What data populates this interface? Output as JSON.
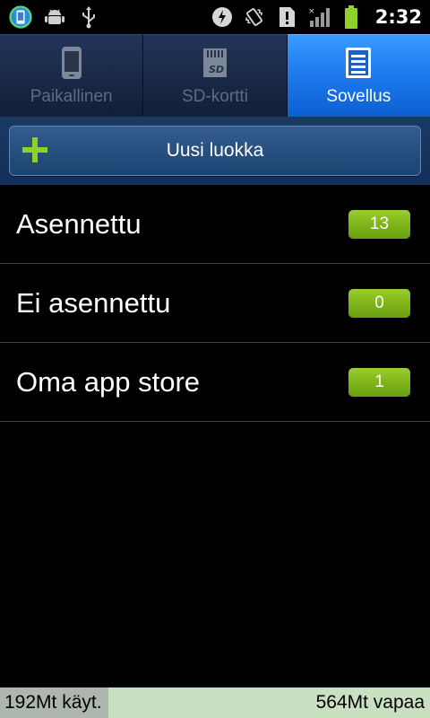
{
  "status_bar": {
    "time": "2:32",
    "icons": [
      "app-notification-icon",
      "android-debug-icon",
      "usb-icon",
      "data-saver-icon",
      "vibrate-icon",
      "alert-icon",
      "signal-icon",
      "battery-icon"
    ]
  },
  "tabs": [
    {
      "label": "Paikallinen",
      "icon": "phone-icon",
      "active": false
    },
    {
      "label": "SD-kortti",
      "icon": "sd-card-icon",
      "active": false
    },
    {
      "label": "Sovellus",
      "icon": "document-icon",
      "active": true
    }
  ],
  "action": {
    "new_label": "Uusi luokka",
    "icon": "plus-icon"
  },
  "categories": [
    {
      "label": "Asennettu",
      "count": "13"
    },
    {
      "label": "Ei asennettu",
      "count": "0"
    },
    {
      "label": "Oma app store",
      "count": "1"
    }
  ],
  "storage": {
    "used_label": "192Mt käyt.",
    "free_label": "564Mt vapaa"
  },
  "colors": {
    "tab_active": "#1e7cf0",
    "badge": "#7fb41a",
    "plus": "#8fd12a",
    "storage_bg": "#c9e1c1"
  }
}
